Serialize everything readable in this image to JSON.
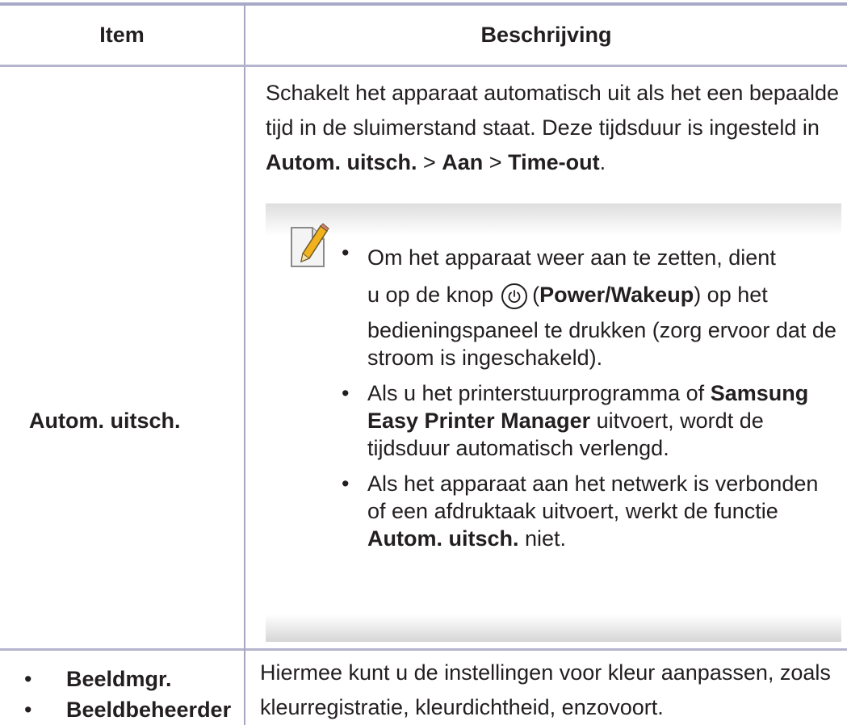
{
  "table": {
    "header": {
      "item": "Item",
      "description": "Beschrijving"
    },
    "row1": {
      "item": "Autom. uitsch.",
      "desc": {
        "p1": "Schakelt het apparaat automatisch uit als het een bepaalde tijd in de sluimerstand staat. Deze tijdsduur is ingesteld in ",
        "b1": "Autom. uitsch.",
        "sep1": " > ",
        "b2": "Aan",
        "sep2": " > ",
        "b3": "Time-out",
        "end": "."
      },
      "note": {
        "icon": "note-pencil-icon",
        "bullet": "•",
        "n1": {
          "a": "Om het apparaat weer aan te zetten, dient",
          "b": "u op de knop",
          "icon": "power-icon",
          "c": "(",
          "bold": "Power/Wakeup",
          "d": ") op het",
          "e": "bedieningspaneel te drukken (zorg ervoor dat de stroom is ingeschakeld)."
        },
        "n2": {
          "a": "Als u het printerstuurprogramma of ",
          "bold": "Samsung Easy Printer Manager",
          "b": " uitvoert, wordt de tijdsduur automatisch verlengd."
        },
        "n3": {
          "a": "Als het apparaat aan het netwerk is verbonden of een afdruktaak uitvoert, werkt de functie ",
          "bold": "Autom. uitsch.",
          "b": " niet."
        }
      }
    },
    "row2": {
      "bullet": "•",
      "items": [
        "Beeldmgr.",
        "Beeldbeheerder"
      ],
      "desc": "Hiermee kunt u de instellingen voor kleur aanpassen, zoals kleurregistratie, kleurdichtheid, enzovoort."
    }
  }
}
